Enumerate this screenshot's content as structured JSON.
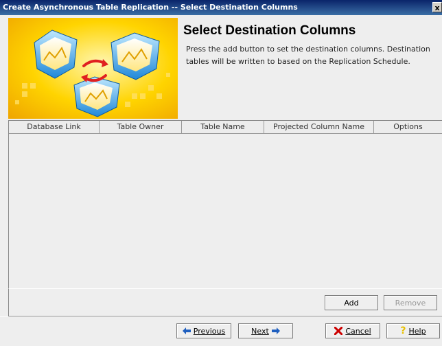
{
  "window": {
    "title": "Create Asynchronous Table Replication -- Select Destination Columns",
    "close_glyph": "x"
  },
  "header": {
    "title": "Select Destination Columns",
    "description": "Press the add button to set the destination columns. Destination tables will be written to based on the Replication Schedule."
  },
  "table": {
    "columns": [
      "Database Link",
      "Table Owner",
      "Table Name",
      "Projected Column Name",
      "Options"
    ],
    "rows": []
  },
  "actions": {
    "add_label": "Add",
    "remove_label": "Remove"
  },
  "footer": {
    "previous_label": "Previous",
    "next_label": "Next",
    "cancel_label": "Cancel",
    "help_label": "Help"
  },
  "icons": {
    "previous": "arrow-left-icon",
    "next": "arrow-right-icon",
    "cancel": "red-x-icon",
    "help": "question-mark-icon"
  },
  "colors": {
    "titlebar": "#0a246a",
    "banner_yellow": "#f5b800",
    "arrow_blue": "#1f5fbf",
    "cancel_red": "#cc0000",
    "help_yellow": "#e8c000"
  }
}
